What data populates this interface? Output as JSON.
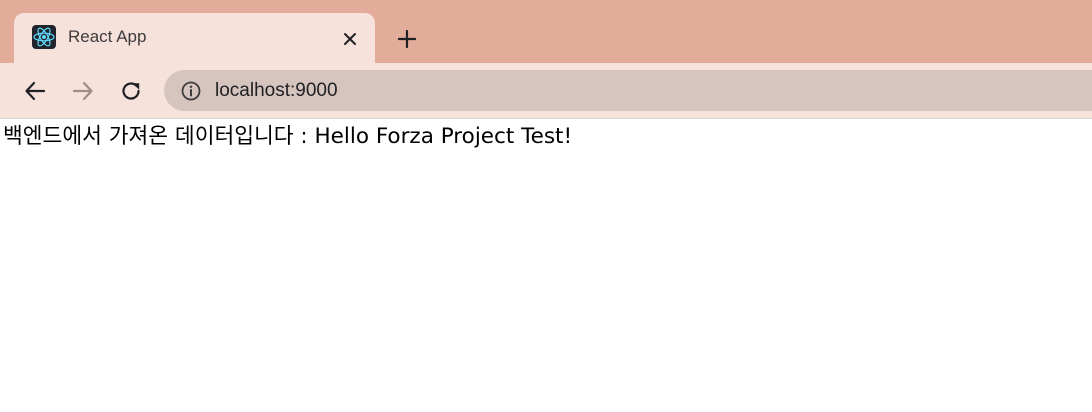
{
  "browser": {
    "tab": {
      "title": "React App",
      "favicon": "react-logo-icon"
    },
    "new_tab_icon": "plus-icon",
    "nav": {
      "back": "back-arrow-icon",
      "forward": "forward-arrow-icon",
      "reload": "reload-icon"
    },
    "address_bar": {
      "url": "localhost:9000",
      "info_icon": "info-icon"
    }
  },
  "page": {
    "message": "백엔드에서 가져온 데이터입니다 : Hello Forza Project Test!"
  }
}
